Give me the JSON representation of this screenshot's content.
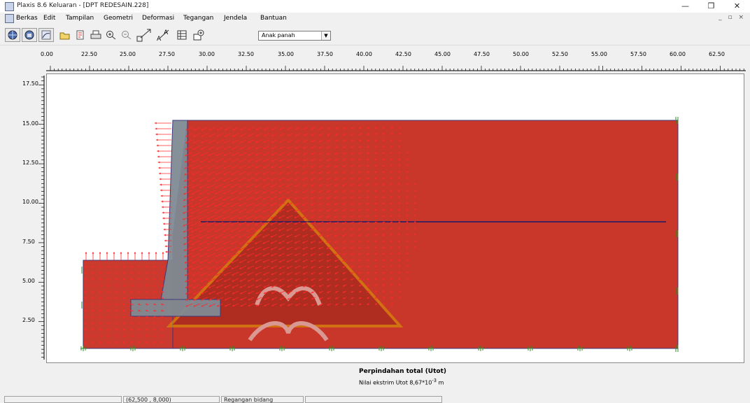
{
  "window": {
    "title": "Plaxis 8.6 Keluaran - [DPT REDESAIN.228]",
    "controls": [
      "—",
      "❐",
      "✕"
    ]
  },
  "menu": {
    "items": [
      "Berkas",
      "Edit",
      "Tampilan",
      "Geometri",
      "Deformasi",
      "Tegangan",
      "Jendela",
      "Bantuan"
    ],
    "mdi_controls": "_ ▫ ×"
  },
  "toolbar": {
    "display_mode": "Anak panah"
  },
  "axes": {
    "x_ticks": [
      "0.00",
      "22.50",
      "25.00",
      "27.50",
      "30.00",
      "32.50",
      "35.00",
      "37.50",
      "40.00",
      "42.50",
      "45.00",
      "47.50",
      "50.00",
      "52.50",
      "55.00",
      "57.50",
      "60.00",
      "62.50"
    ],
    "y_ticks": [
      "17.50",
      "15.00",
      "12.50",
      "10.00",
      "7.50",
      "5.00",
      "2.50"
    ]
  },
  "result": {
    "title": "Perpindahan total (Utot)",
    "extreme_prefix": "Nilai ekstrim Utot 8,67*10",
    "extreme_exp": "-3",
    "extreme_unit": "m"
  },
  "status": {
    "coords": "(62,500 , 8,000)",
    "model": "Regangan bidang"
  },
  "colors": {
    "soil": "#c9362a",
    "soil_edge": "#3a3a7a",
    "wall": "#7f8a93",
    "arrows": "#ff2a2a",
    "water_line": "#1b1b6b",
    "fixity": "#2e8b2e",
    "watermark": "#d8a200"
  }
}
